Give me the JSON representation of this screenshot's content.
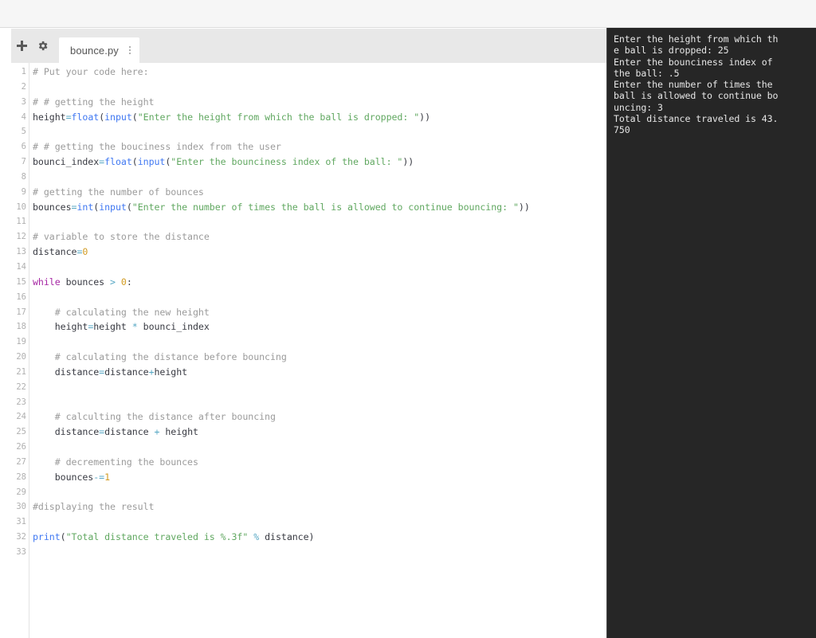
{
  "window": {
    "top_strip": ""
  },
  "toolbar": {
    "add_tab_label": "+",
    "add_tab_icon": "plus-icon",
    "settings_icon": "gear-icon"
  },
  "tabs": [
    {
      "label": "bounce.py",
      "active": true,
      "menu_icon": "vertical-ellipsis-icon"
    }
  ],
  "editor": {
    "language": "python",
    "first_line": 1,
    "last_line": 33,
    "line_numbers": [
      "1",
      "2",
      "3",
      "4",
      "5",
      "6",
      "7",
      "8",
      "9",
      "10",
      "11",
      "12",
      "13",
      "14",
      "15",
      "16",
      "17",
      "18",
      "19",
      "20",
      "21",
      "22",
      "23",
      "24",
      "25",
      "26",
      "27",
      "28",
      "29",
      "30",
      "31",
      "32",
      "33"
    ],
    "lines": [
      {
        "n": 1,
        "tokens": [
          {
            "t": "# Put your code here:",
            "c": "t-com"
          }
        ]
      },
      {
        "n": 2,
        "tokens": []
      },
      {
        "n": 3,
        "tokens": [
          {
            "t": "# # getting the height",
            "c": "t-com"
          }
        ]
      },
      {
        "n": 4,
        "tokens": [
          {
            "t": "height",
            "c": "t-pln"
          },
          {
            "t": "=",
            "c": "t-op"
          },
          {
            "t": "float",
            "c": "t-fn"
          },
          {
            "t": "(",
            "c": "t-pln"
          },
          {
            "t": "input",
            "c": "t-fn"
          },
          {
            "t": "(",
            "c": "t-pln"
          },
          {
            "t": "\"Enter the height from which the ball is dropped: \"",
            "c": "t-str"
          },
          {
            "t": "))",
            "c": "t-pln"
          }
        ]
      },
      {
        "n": 5,
        "tokens": []
      },
      {
        "n": 6,
        "tokens": [
          {
            "t": "# # getting the bouciness index from the user",
            "c": "t-com"
          }
        ]
      },
      {
        "n": 7,
        "tokens": [
          {
            "t": "bounci_index",
            "c": "t-pln"
          },
          {
            "t": "=",
            "c": "t-op"
          },
          {
            "t": "float",
            "c": "t-fn"
          },
          {
            "t": "(",
            "c": "t-pln"
          },
          {
            "t": "input",
            "c": "t-fn"
          },
          {
            "t": "(",
            "c": "t-pln"
          },
          {
            "t": "\"Enter the bounciness index of the ball: \"",
            "c": "t-str"
          },
          {
            "t": "))",
            "c": "t-pln"
          }
        ]
      },
      {
        "n": 8,
        "tokens": []
      },
      {
        "n": 9,
        "tokens": [
          {
            "t": "# getting the number of bounces",
            "c": "t-com"
          }
        ]
      },
      {
        "n": 10,
        "tokens": [
          {
            "t": "bounces",
            "c": "t-pln"
          },
          {
            "t": "=",
            "c": "t-op"
          },
          {
            "t": "int",
            "c": "t-fn"
          },
          {
            "t": "(",
            "c": "t-pln"
          },
          {
            "t": "input",
            "c": "t-fn"
          },
          {
            "t": "(",
            "c": "t-pln"
          },
          {
            "t": "\"Enter the number of times the ball is allowed to continue bouncing: \"",
            "c": "t-str"
          },
          {
            "t": "))",
            "c": "t-pln"
          }
        ]
      },
      {
        "n": 11,
        "tokens": []
      },
      {
        "n": 12,
        "tokens": [
          {
            "t": "# variable to store the distance",
            "c": "t-com"
          }
        ]
      },
      {
        "n": 13,
        "tokens": [
          {
            "t": "distance",
            "c": "t-pln"
          },
          {
            "t": "=",
            "c": "t-op"
          },
          {
            "t": "0",
            "c": "t-num"
          }
        ]
      },
      {
        "n": 14,
        "tokens": []
      },
      {
        "n": 15,
        "tokens": [
          {
            "t": "while",
            "c": "t-kw"
          },
          {
            "t": " bounces ",
            "c": "t-pln"
          },
          {
            "t": ">",
            "c": "t-op"
          },
          {
            "t": " ",
            "c": "t-pln"
          },
          {
            "t": "0",
            "c": "t-num"
          },
          {
            "t": ":",
            "c": "t-pln"
          }
        ]
      },
      {
        "n": 16,
        "tokens": []
      },
      {
        "n": 17,
        "tokens": [
          {
            "t": "    # calculating the new height",
            "c": "t-com"
          }
        ]
      },
      {
        "n": 18,
        "tokens": [
          {
            "t": "    height",
            "c": "t-pln"
          },
          {
            "t": "=",
            "c": "t-op"
          },
          {
            "t": "height ",
            "c": "t-pln"
          },
          {
            "t": "*",
            "c": "t-op"
          },
          {
            "t": " bounci_index",
            "c": "t-pln"
          }
        ]
      },
      {
        "n": 19,
        "tokens": []
      },
      {
        "n": 20,
        "tokens": [
          {
            "t": "    # calculating the distance before bouncing",
            "c": "t-com"
          }
        ]
      },
      {
        "n": 21,
        "tokens": [
          {
            "t": "    distance",
            "c": "t-pln"
          },
          {
            "t": "=",
            "c": "t-op"
          },
          {
            "t": "distance",
            "c": "t-pln"
          },
          {
            "t": "+",
            "c": "t-op"
          },
          {
            "t": "height",
            "c": "t-pln"
          }
        ]
      },
      {
        "n": 22,
        "tokens": []
      },
      {
        "n": 23,
        "tokens": []
      },
      {
        "n": 24,
        "tokens": [
          {
            "t": "    # calculting the distance after bouncing",
            "c": "t-com"
          }
        ]
      },
      {
        "n": 25,
        "tokens": [
          {
            "t": "    distance",
            "c": "t-pln"
          },
          {
            "t": "=",
            "c": "t-op"
          },
          {
            "t": "distance ",
            "c": "t-pln"
          },
          {
            "t": "+",
            "c": "t-op"
          },
          {
            "t": " height",
            "c": "t-pln"
          }
        ]
      },
      {
        "n": 26,
        "tokens": []
      },
      {
        "n": 27,
        "tokens": [
          {
            "t": "    # decrementing the bounces",
            "c": "t-com"
          }
        ]
      },
      {
        "n": 28,
        "tokens": [
          {
            "t": "    bounces",
            "c": "t-pln"
          },
          {
            "t": "-=",
            "c": "t-op"
          },
          {
            "t": "1",
            "c": "t-num"
          }
        ]
      },
      {
        "n": 29,
        "tokens": []
      },
      {
        "n": 30,
        "tokens": [
          {
            "t": "#displaying the result",
            "c": "t-com"
          }
        ]
      },
      {
        "n": 31,
        "tokens": []
      },
      {
        "n": 32,
        "tokens": [
          {
            "t": "print",
            "c": "t-fn"
          },
          {
            "t": "(",
            "c": "t-pln"
          },
          {
            "t": "\"Total distance traveled is %.3f\"",
            "c": "t-str"
          },
          {
            "t": " ",
            "c": "t-pln"
          },
          {
            "t": "%",
            "c": "t-op"
          },
          {
            "t": " distance)",
            "c": "t-pln"
          }
        ]
      },
      {
        "n": 33,
        "tokens": []
      }
    ]
  },
  "terminal": {
    "background": "#262626",
    "text_color": "#e6e6e6",
    "lines": [
      "Enter the height from which th",
      "e ball is dropped: 25",
      "Enter the bounciness index of",
      "the ball: .5",
      "Enter the number of times the",
      "ball is allowed to continue bo",
      "uncing: 3",
      "Total distance traveled is 43.",
      "750"
    ],
    "inputs": {
      "height": "25",
      "bounciness_index": ".5",
      "bounces": "3"
    },
    "result": "43.750"
  },
  "colors": {
    "comment": "#9b9b9b",
    "function": "#4078f2",
    "string": "#61a861",
    "number": "#d19a20",
    "keyword": "#a626a4",
    "operator": "#56a7c4",
    "plain": "#383a42",
    "tab_bar": "#e8e8e8",
    "terminal_bg": "#262626"
  }
}
